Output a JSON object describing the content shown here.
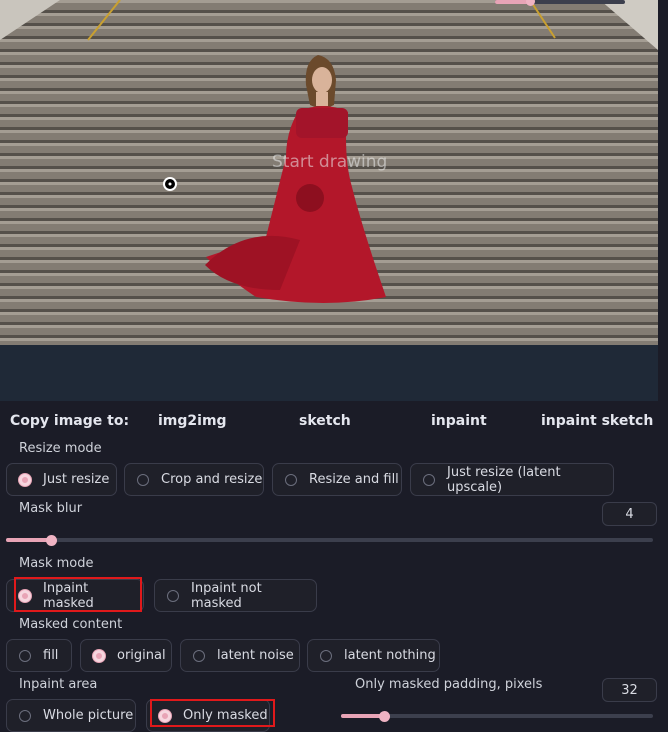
{
  "canvas": {
    "placeholder": "Start drawing"
  },
  "copy_image": {
    "label": "Copy image to:",
    "targets": [
      "img2img",
      "sketch",
      "inpaint",
      "inpaint sketch"
    ]
  },
  "resize_mode": {
    "label": "Resize mode",
    "options": [
      "Just resize",
      "Crop and resize",
      "Resize and fill",
      "Just resize (latent upscale)"
    ],
    "selected": "Just resize"
  },
  "mask_blur": {
    "label": "Mask blur",
    "value": "4",
    "min": 0,
    "max": 64
  },
  "mask_mode": {
    "label": "Mask mode",
    "options": [
      "Inpaint masked",
      "Inpaint not masked"
    ],
    "selected": "Inpaint masked"
  },
  "masked_content": {
    "label": "Masked content",
    "options": [
      "fill",
      "original",
      "latent noise",
      "latent nothing"
    ],
    "selected": "original"
  },
  "inpaint_area": {
    "label": "Inpaint area",
    "options": [
      "Whole picture",
      "Only masked"
    ],
    "selected": "Only masked"
  },
  "padding": {
    "label": "Only masked padding, pixels",
    "value": "32",
    "min": 0,
    "max": 256
  },
  "colors": {
    "accent": "#e8a4b6",
    "highlight": "#e0191b",
    "background": "#1b1c27"
  }
}
